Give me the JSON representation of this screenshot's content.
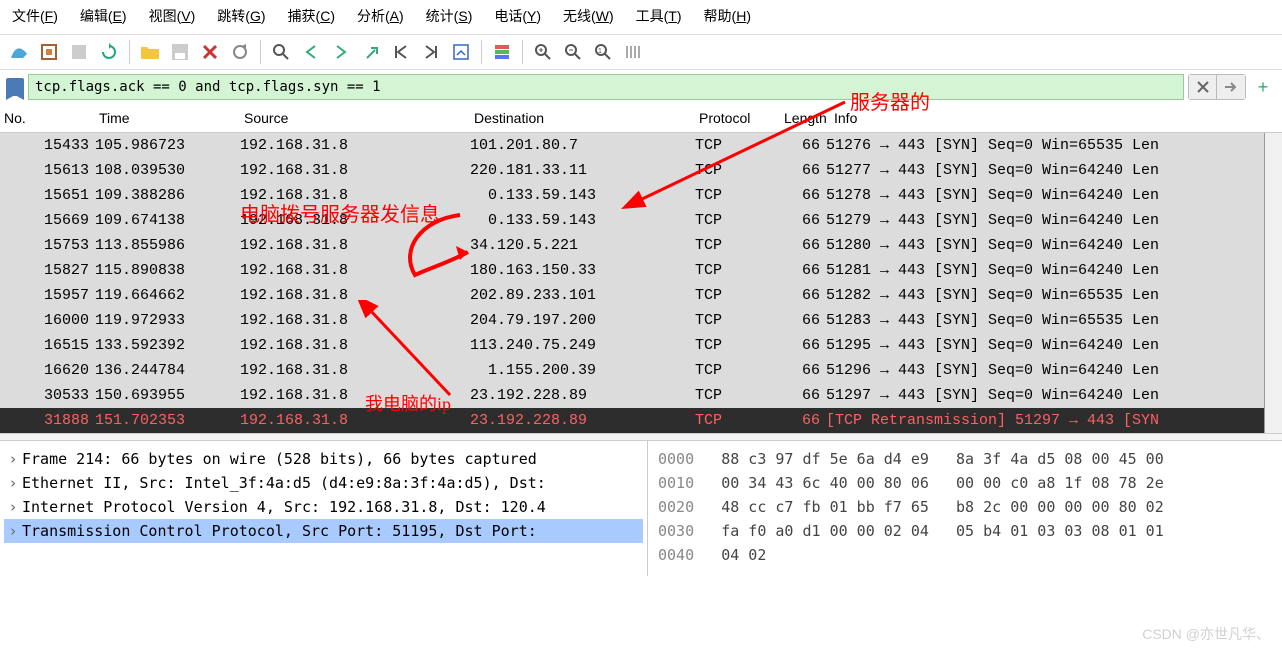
{
  "menu": [
    "文件(<u>F</u>)",
    "编辑(<u>E</u>)",
    "视图(<u>V</u>)",
    "跳转(<u>G</u>)",
    "捕获(<u>C</u>)",
    "分析(<u>A</u>)",
    "统计(<u>S</u>)",
    "电话(<u>Y</u>)",
    "无线(<u>W</u>)",
    "工具(<u>T</u>)",
    "帮助(<u>H</u>)"
  ],
  "filter_value": "tcp.flags.ack == 0 and tcp.flags.syn == 1",
  "columns": {
    "no": "No.",
    "time": "Time",
    "source": "Source",
    "dest": "Destination",
    "proto": "Protocol",
    "len": "Length",
    "info": "Info"
  },
  "rows": [
    {
      "no": "15433",
      "time": "105.986723",
      "src": "192.168.31.8",
      "dst": "101.201.80.7",
      "proto": "TCP",
      "len": "66",
      "info": "51276 → 443 [SYN] Seq=0 Win=65535 Len",
      "cls": "gray-row"
    },
    {
      "no": "15613",
      "time": "108.039530",
      "src": "192.168.31.8",
      "dst": "220.181.33.11",
      "proto": "TCP",
      "len": "66",
      "info": "51277 → 443 [SYN] Seq=0 Win=64240 Len",
      "cls": "gray-row"
    },
    {
      "no": "15651",
      "time": "109.388286",
      "src": "192.168.31.8",
      "dst": "  0.133.59.143",
      "proto": "TCP",
      "len": "66",
      "info": "51278 → 443 [SYN] Seq=0 Win=64240 Len",
      "cls": "gray-row"
    },
    {
      "no": "15669",
      "time": "109.674138",
      "src": "192.168.31.8",
      "dst": "  0.133.59.143",
      "proto": "TCP",
      "len": "66",
      "info": "51279 → 443 [SYN] Seq=0 Win=64240 Len",
      "cls": "gray-row"
    },
    {
      "no": "15753",
      "time": "113.855986",
      "src": "192.168.31.8",
      "dst": "34.120.5.221",
      "proto": "TCP",
      "len": "66",
      "info": "51280 → 443 [SYN] Seq=0 Win=64240 Len",
      "cls": "gray-row"
    },
    {
      "no": "15827",
      "time": "115.890838",
      "src": "192.168.31.8",
      "dst": "180.163.150.33",
      "proto": "TCP",
      "len": "66",
      "info": "51281 → 443 [SYN] Seq=0 Win=64240 Len",
      "cls": "gray-row"
    },
    {
      "no": "15957",
      "time": "119.664662",
      "src": "192.168.31.8",
      "dst": "202.89.233.101",
      "proto": "TCP",
      "len": "66",
      "info": "51282 → 443 [SYN] Seq=0 Win=65535 Len",
      "cls": "gray-row"
    },
    {
      "no": "16000",
      "time": "119.972933",
      "src": "192.168.31.8",
      "dst": "204.79.197.200",
      "proto": "TCP",
      "len": "66",
      "info": "51283 → 443 [SYN] Seq=0 Win=65535 Len",
      "cls": "gray-row"
    },
    {
      "no": "16515",
      "time": "133.592392",
      "src": "192.168.31.8",
      "dst": "113.240.75.249",
      "proto": "TCP",
      "len": "66",
      "info": "51295 → 443 [SYN] Seq=0 Win=64240 Len",
      "cls": "gray-row"
    },
    {
      "no": "16620",
      "time": "136.244784",
      "src": "192.168.31.8",
      "dst": "  1.155.200.39",
      "proto": "TCP",
      "len": "66",
      "info": "51296 → 443 [SYN] Seq=0 Win=64240 Len",
      "cls": "gray-row"
    },
    {
      "no": "30533",
      "time": "150.693955",
      "src": "192.168.31.8",
      "dst": "23.192.228.89",
      "proto": "TCP",
      "len": "66",
      "info": "51297 → 443 [SYN] Seq=0 Win=64240 Len",
      "cls": "gray-row"
    },
    {
      "no": "31888",
      "time": "151.702353",
      "src": "192.168.31.8",
      "dst": "23.192.228.89",
      "proto": "TCP",
      "len": "66",
      "info": "[TCP Retransmission] 51297 → 443 [SYN",
      "cls": "dark-row"
    }
  ],
  "tree": [
    "Frame 214: 66 bytes on wire (528 bits), 66 bytes captured",
    "Ethernet II, Src: Intel_3f:4a:d5 (d4:e9:8a:3f:4a:d5), Dst:",
    "Internet Protocol Version 4, Src: 192.168.31.8, Dst: 120.4",
    "Transmission Control Protocol, Src Port: 51195, Dst Port: "
  ],
  "hex": [
    {
      "off": "0000",
      "b": "88 c3 97 df 5e 6a d4 e9   8a 3f 4a d5 08 00 45 00"
    },
    {
      "off": "0010",
      "b": "00 34 43 6c 40 00 80 06   00 00 c0 a8 1f 08 78 2e"
    },
    {
      "off": "0020",
      "b": "48 cc c7 fb 01 bb f7 65   b8 2c 00 00 00 00 80 02"
    },
    {
      "off": "0030",
      "b": "fa f0 a0 d1 00 00 02 04   05 b4 01 03 03 08 01 01"
    },
    {
      "off": "0040",
      "b": "04 02"
    }
  ],
  "annotations": {
    "server": "服务器的",
    "dial": "电脑拨号服务器发信息",
    "myip": "我电脑的ip"
  },
  "watermark": "CSDN @亦世凡华、"
}
